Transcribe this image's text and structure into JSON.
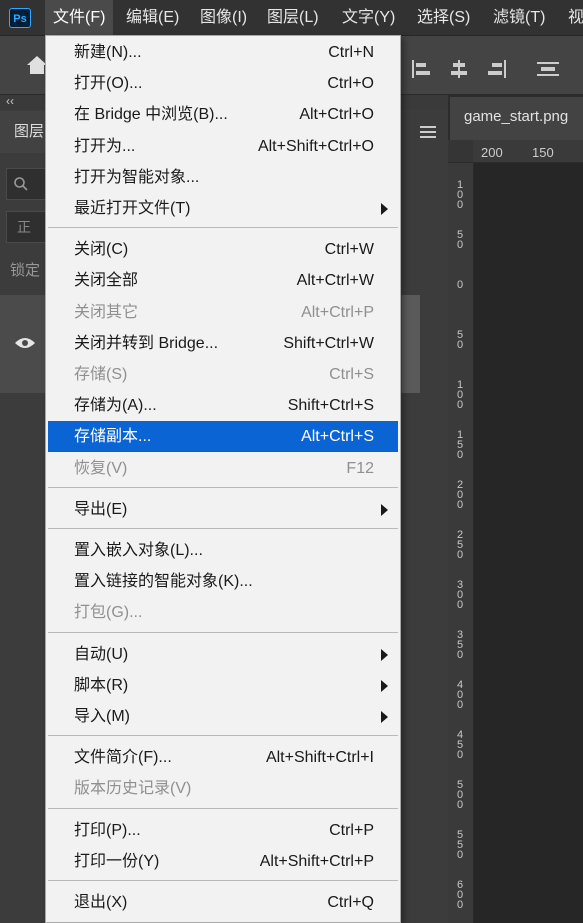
{
  "app": {
    "logo": "Ps"
  },
  "menubar": {
    "items": [
      {
        "label": "文件(F)"
      },
      {
        "label": "编辑(E)"
      },
      {
        "label": "图像(I)"
      },
      {
        "label": "图层(L)"
      },
      {
        "label": "文字(Y)"
      },
      {
        "label": "选择(S)"
      },
      {
        "label": "滤镜(T)"
      },
      {
        "label": "视"
      }
    ]
  },
  "layers_panel": {
    "tab_label": "图层",
    "filter_placeholder": "",
    "blend_mode": "正",
    "lock_label": "锁定"
  },
  "document": {
    "tab_title": "game_start.png",
    "ruler_h": [
      "200",
      "150"
    ],
    "ruler_v": [
      "100",
      "50",
      "0",
      "50",
      "100",
      "150",
      "200",
      "250",
      "300",
      "350",
      "400",
      "450",
      "500",
      "550",
      "600"
    ]
  },
  "file_menu": {
    "groups": [
      [
        {
          "label": "新建(N)...",
          "shortcut": "Ctrl+N"
        },
        {
          "label": "打开(O)...",
          "shortcut": "Ctrl+O"
        },
        {
          "label": "在 Bridge 中浏览(B)...",
          "shortcut": "Alt+Ctrl+O"
        },
        {
          "label": "打开为...",
          "shortcut": "Alt+Shift+Ctrl+O"
        },
        {
          "label": "打开为智能对象...",
          "shortcut": ""
        },
        {
          "label": "最近打开文件(T)",
          "shortcut": "",
          "submenu": true
        }
      ],
      [
        {
          "label": "关闭(C)",
          "shortcut": "Ctrl+W"
        },
        {
          "label": "关闭全部",
          "shortcut": "Alt+Ctrl+W"
        },
        {
          "label": "关闭其它",
          "shortcut": "Alt+Ctrl+P",
          "disabled": true
        },
        {
          "label": "关闭并转到 Bridge...",
          "shortcut": "Shift+Ctrl+W"
        },
        {
          "label": "存储(S)",
          "shortcut": "Ctrl+S",
          "disabled": true
        },
        {
          "label": "存储为(A)...",
          "shortcut": "Shift+Ctrl+S"
        },
        {
          "label": "存储副本...",
          "shortcut": "Alt+Ctrl+S",
          "highlighted": true
        },
        {
          "label": "恢复(V)",
          "shortcut": "F12",
          "disabled": true
        }
      ],
      [
        {
          "label": "导出(E)",
          "shortcut": "",
          "submenu": true
        }
      ],
      [
        {
          "label": "置入嵌入对象(L)...",
          "shortcut": ""
        },
        {
          "label": "置入链接的智能对象(K)...",
          "shortcut": ""
        },
        {
          "label": "打包(G)...",
          "shortcut": "",
          "disabled": true
        }
      ],
      [
        {
          "label": "自动(U)",
          "shortcut": "",
          "submenu": true
        },
        {
          "label": "脚本(R)",
          "shortcut": "",
          "submenu": true
        },
        {
          "label": "导入(M)",
          "shortcut": "",
          "submenu": true
        }
      ],
      [
        {
          "label": "文件简介(F)...",
          "shortcut": "Alt+Shift+Ctrl+I"
        },
        {
          "label": "版本历史记录(V)",
          "shortcut": "",
          "disabled": true
        }
      ],
      [
        {
          "label": "打印(P)...",
          "shortcut": "Ctrl+P"
        },
        {
          "label": "打印一份(Y)",
          "shortcut": "Alt+Shift+Ctrl+P"
        }
      ],
      [
        {
          "label": "退出(X)",
          "shortcut": "Ctrl+Q"
        }
      ]
    ]
  },
  "colors": {
    "highlight": "#0a64d4",
    "menu_bg": "#f2f2f2",
    "app_bg": "#535353"
  }
}
